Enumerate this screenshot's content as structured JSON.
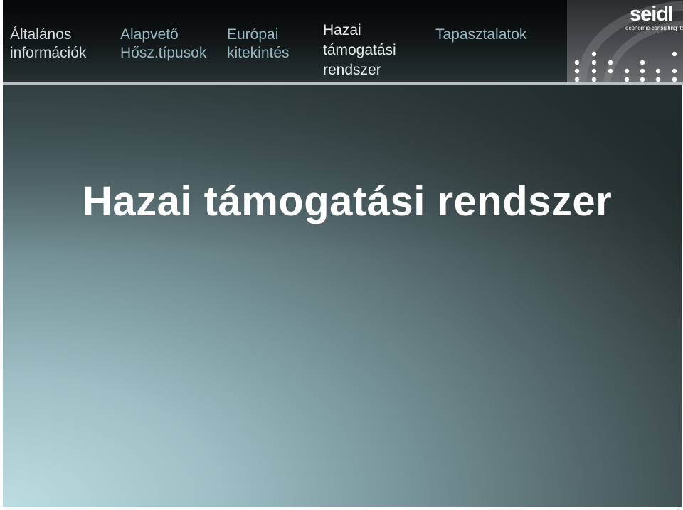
{
  "nav": {
    "items": [
      {
        "lines": [
          "Általános",
          "információk"
        ]
      },
      {
        "lines": [
          "Alapvető",
          "Hősz.típusok"
        ]
      },
      {
        "lines": [
          "Európai",
          "kitekintés"
        ]
      },
      {
        "lines": [
          "Hazai",
          "támogatási",
          "rendszer"
        ]
      },
      {
        "lines": [
          "Tapasztalatok"
        ]
      }
    ],
    "active_index": 3
  },
  "logo": {
    "name": "seidl",
    "tagline": "economic consulting ltd."
  },
  "slide": {
    "title": "Hazai támogatási rendszer"
  },
  "colors": {
    "topbar": "#0f1415",
    "nav_text": "#98b8c4",
    "nav_active_text": "#e9eff1",
    "title_text": "#ffffff",
    "divider": "#b9bfc0"
  },
  "icons": [
    "seidl-logo-icon"
  ]
}
